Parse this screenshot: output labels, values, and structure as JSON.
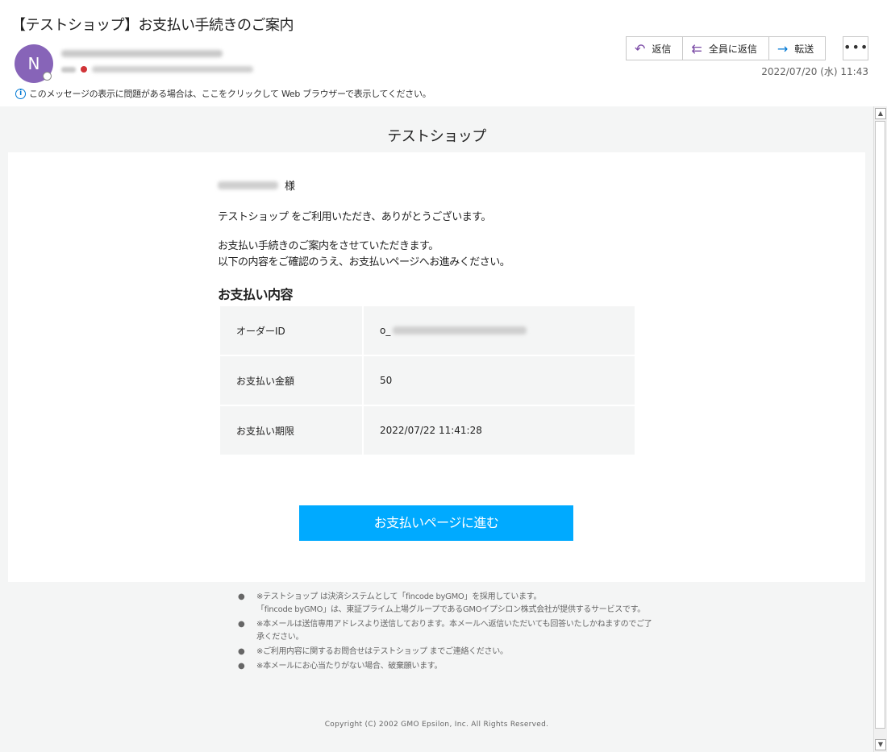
{
  "header": {
    "subject": "【テストショップ】お支払い手続きのご案内",
    "avatar_initial": "N",
    "date": "2022/07/20 (水) 11:43",
    "info_bar": "このメッセージの表示に問題がある場合は、ここをクリックして Web ブラウザーで表示してください。",
    "actions": {
      "reply": "返信",
      "reply_all": "全員に返信",
      "forward": "転送",
      "more": "•••"
    }
  },
  "email": {
    "shop_name": "テストショップ",
    "salutation_suffix": "様",
    "thanks": "テストショップ をご利用いただき、ありがとうございます。",
    "guide_line1": "お支払い手続きのご案内をさせていただきます。",
    "guide_line2": "以下の内容をご確認のうえ、お支払いページへお進みください。",
    "section_title": "お支払い内容",
    "details": [
      {
        "label": "オーダーID",
        "value": "o_"
      },
      {
        "label": "お支払い金額",
        "value": "50"
      },
      {
        "label": "お支払い期限",
        "value": "2022/07/22 11:41:28"
      }
    ],
    "pay_button": "お支払いページに進む",
    "notes": [
      {
        "bullet": "●",
        "text": "※テストショップ は決済システムとして「fincode byGMO」を採用しています。"
      },
      {
        "bullet": "",
        "text": "「fincode byGMO」は、東証プライム上場グループであるGMOイプシロン株式会社が提供するサービスです。"
      },
      {
        "bullet": "●",
        "text": "※本メールは送信専用アドレスより送信しております。本メールへ返信いただいても回答いたしかねますのでご了承ください。"
      },
      {
        "bullet": "●",
        "text": "※ご利用内容に関するお問合せはテストショップ までご連絡ください。"
      },
      {
        "bullet": "●",
        "text": "※本メールにお心当たりがない場合、破棄願います。"
      }
    ],
    "copyright": "Copyright (C) 2002 GMO Epsilon, Inc. All Rights Reserved."
  },
  "icons": {
    "reply": "reply-arrow-icon",
    "reply_all": "reply-all-arrow-icon",
    "forward": "forward-arrow-icon",
    "info": "info-icon"
  },
  "colors": {
    "avatar": "#8764b8",
    "pay_button": "#00aaff",
    "reply_icon": "#7a4aa5",
    "forward_icon": "#0078d4"
  }
}
